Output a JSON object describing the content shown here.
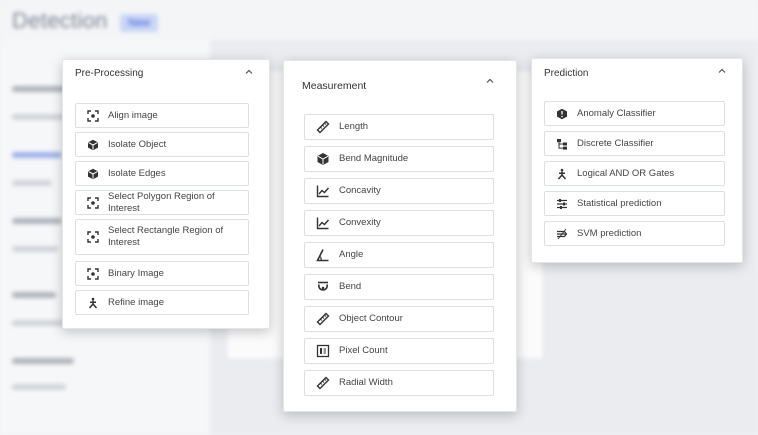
{
  "background": {
    "title": "Detection",
    "badge": "New"
  },
  "colors": {
    "icon": "#333333",
    "panel_bg": "#ffffff",
    "item_border": "#dcdfe4"
  },
  "panels": {
    "preprocessing": {
      "title": "Pre-Processing",
      "items": [
        {
          "label": "Align image",
          "icon": "focus-frame-icon"
        },
        {
          "label": "Isolate Object",
          "icon": "cube-icon"
        },
        {
          "label": "Isolate Edges",
          "icon": "cube-icon"
        },
        {
          "label": "Select Polygon Region of Interest",
          "icon": "focus-frame-icon"
        },
        {
          "label": "Select Rectangle Region of Interest",
          "icon": "focus-frame-icon"
        },
        {
          "label": "Binary Image",
          "icon": "focus-frame-icon"
        },
        {
          "label": "Refine image",
          "icon": "person-icon"
        }
      ]
    },
    "measurement": {
      "title": "Measurement",
      "items": [
        {
          "label": "Length",
          "icon": "ruler-icon"
        },
        {
          "label": "Bend Magnitude",
          "icon": "cube-icon"
        },
        {
          "label": "Concavity",
          "icon": "line-chart-icon"
        },
        {
          "label": "Convexity",
          "icon": "line-chart-icon"
        },
        {
          "label": "Angle",
          "icon": "angle-icon"
        },
        {
          "label": "Bend",
          "icon": "bend-icon"
        },
        {
          "label": "Object Contour",
          "icon": "ruler-icon"
        },
        {
          "label": "Pixel Count",
          "icon": "pixel-count-icon"
        },
        {
          "label": "Radial Width",
          "icon": "ruler-icon"
        }
      ]
    },
    "prediction": {
      "title": "Prediction",
      "items": [
        {
          "label": "Anomaly Classifier",
          "icon": "anomaly-icon"
        },
        {
          "label": "Discrete Classifier",
          "icon": "hierarchy-icon"
        },
        {
          "label": "Logical AND OR Gates",
          "icon": "person-icon"
        },
        {
          "label": "Statistical prediction",
          "icon": "sliders-icon"
        },
        {
          "label": "SVM prediction",
          "icon": "svm-icon"
        }
      ]
    }
  }
}
